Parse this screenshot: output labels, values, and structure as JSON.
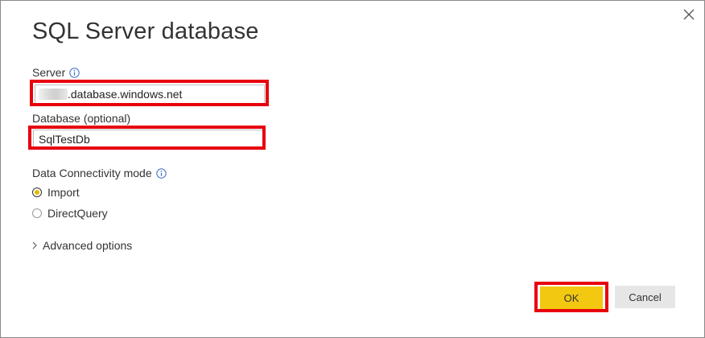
{
  "dialog": {
    "title": "SQL Server database",
    "close_icon": "close-icon"
  },
  "server": {
    "label": "Server",
    "info_icon": "info-icon",
    "value_suffix": ".database.windows.net"
  },
  "database": {
    "label": "Database (optional)",
    "value": "SqlTestDb"
  },
  "connectivity": {
    "label": "Data Connectivity mode",
    "info_icon": "info-icon",
    "options": [
      {
        "label": "Import",
        "selected": true
      },
      {
        "label": "DirectQuery",
        "selected": false
      }
    ]
  },
  "advanced": {
    "label": "Advanced options",
    "icon": "chevron-right-icon"
  },
  "buttons": {
    "ok_label": "OK",
    "cancel_label": "Cancel"
  },
  "colors": {
    "highlight": "#e8000d",
    "ok_button": "#f2c811",
    "radio_selected": "#e8b800",
    "cancel_button": "#e6e6e6"
  }
}
